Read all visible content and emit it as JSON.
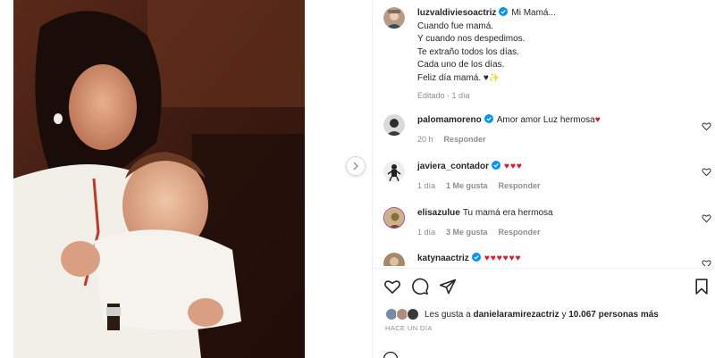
{
  "post": {
    "author": "luzvaldiviesoactriz",
    "caption_title": "Mi Mamá...",
    "caption_lines": [
      "Cuando fue mamá.",
      "Y cuando nos despedimos.",
      "Te extraño todos los días.",
      "Cada uno de los días.",
      "Feliz día mamá. ♥✨"
    ],
    "edited_label": "Editado",
    "edited_time": "1 día"
  },
  "comments": [
    {
      "user": "palomamoreno",
      "verified": true,
      "text": "Amor amor Luz hermosa",
      "hearts": "♥",
      "time": "20 h",
      "likes": "",
      "reply": "Responder"
    },
    {
      "user": "javiera_contador",
      "verified": true,
      "text": "",
      "hearts": "♥♥♥",
      "time": "1 día",
      "likes": "1 Me gusta",
      "reply": "Responder"
    },
    {
      "user": "elisazulue",
      "verified": false,
      "text": "Tu mamá era hermosa",
      "hearts": "",
      "time": "1 día",
      "likes": "3 Me gusta",
      "reply": "Responder"
    },
    {
      "user": "katynaactriz",
      "verified": true,
      "text": "",
      "hearts": "♥♥♥♥♥♥",
      "time": "",
      "likes": "",
      "reply": ""
    }
  ],
  "likes": {
    "prefix": "Les gusta a",
    "first_user": "danielaramirezactriz",
    "connector": "y",
    "others": "10.067 personas más"
  },
  "timestamp": "HACE UN DÍA",
  "icons": {
    "like": "heart-icon",
    "comment": "comment-icon",
    "share": "share-icon",
    "save": "bookmark-icon",
    "next": "chevron-right-icon",
    "emoji": "emoji-icon"
  },
  "colors": {
    "verified": "#0095f6",
    "heart": "#e0152a",
    "meta": "#8e8e8e"
  }
}
